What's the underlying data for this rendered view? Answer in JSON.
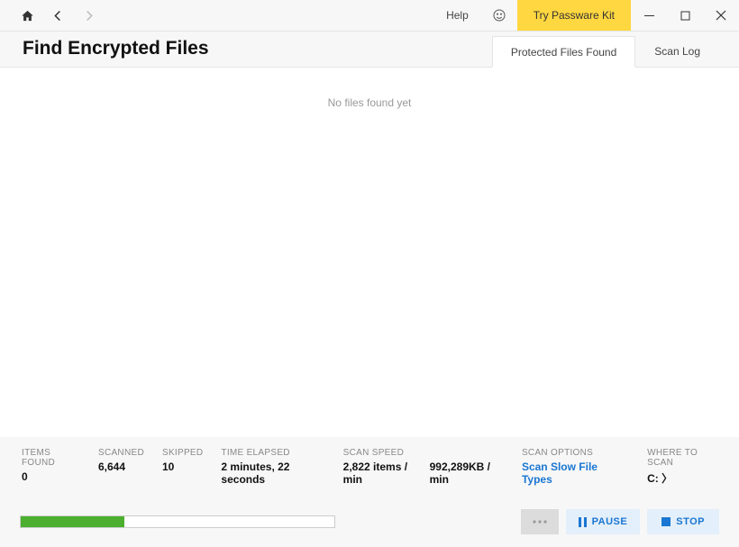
{
  "toolbar": {
    "help_label": "Help",
    "try_label": "Try Passware Kit"
  },
  "header": {
    "title": "Find Encrypted Files",
    "tabs": {
      "protected": "Protected Files Found",
      "scanlog": "Scan Log"
    }
  },
  "main": {
    "empty_message": "No files found yet"
  },
  "stats": {
    "items_found": {
      "label": "ITEMS FOUND",
      "value": "0"
    },
    "scanned": {
      "label": "SCANNED",
      "value": "6,644"
    },
    "skipped": {
      "label": "SKIPPED",
      "value": "10"
    },
    "time_elapsed": {
      "label": "TIME ELAPSED",
      "value": "2 minutes, 22 seconds"
    },
    "scan_speed": {
      "label": "SCAN SPEED",
      "items": "2,822 items / min",
      "kb": "992,289KB / min"
    },
    "scan_options": {
      "label": "SCAN OPTIONS",
      "value": "Scan Slow File Types"
    },
    "where_to_scan": {
      "label": "WHERE TO SCAN",
      "value": "C: 〉"
    }
  },
  "progress": {
    "percent": 33
  },
  "buttons": {
    "pause": "PAUSE",
    "stop": "STOP"
  }
}
